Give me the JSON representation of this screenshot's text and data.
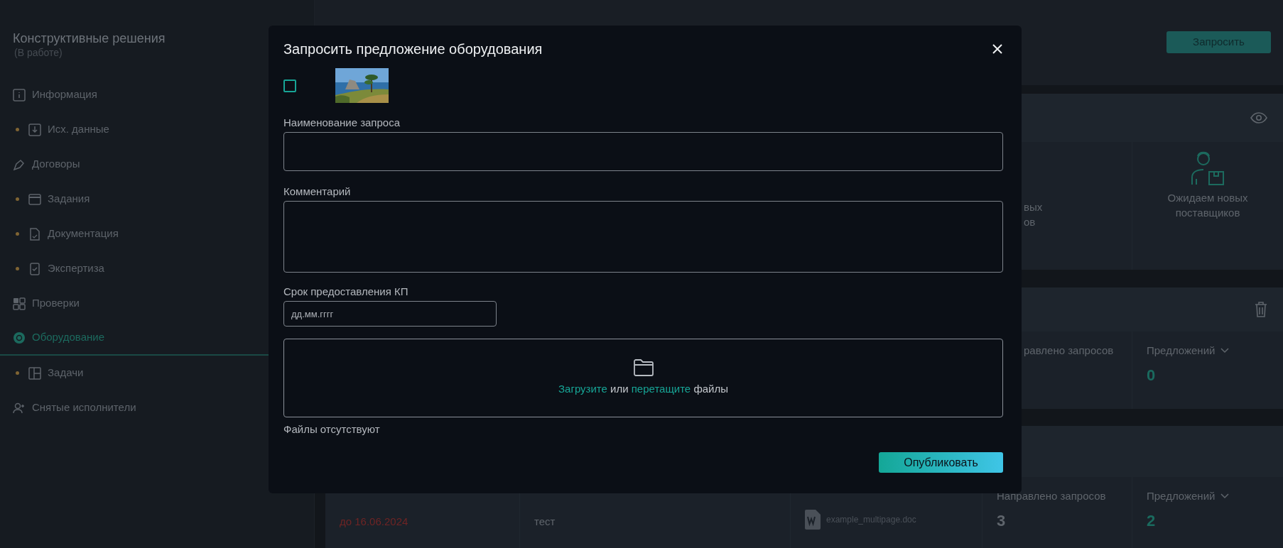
{
  "sidebar": {
    "title": "Конструктивные решения",
    "status": "(В работе)",
    "items": [
      {
        "label": "Информация",
        "flagged": false,
        "selected": false
      },
      {
        "label": "Исх. данные",
        "flagged": true,
        "selected": false
      },
      {
        "label": "Договоры",
        "flagged": false,
        "selected": false
      },
      {
        "label": "Задания",
        "flagged": true,
        "selected": false
      },
      {
        "label": "Документация",
        "flagged": true,
        "selected": false
      },
      {
        "label": "Экспертиза",
        "flagged": true,
        "selected": false
      },
      {
        "label": "Проверки",
        "flagged": false,
        "selected": false
      },
      {
        "label": "Оборудование",
        "flagged": false,
        "selected": true
      },
      {
        "label": "Задачи",
        "flagged": true,
        "selected": false
      },
      {
        "label": "Снятые исполнители",
        "flagged": false,
        "selected": false
      }
    ]
  },
  "header": {
    "request_button": "Запросить"
  },
  "summary_card": {
    "partial_lines": [
      "вых",
      "ов"
    ],
    "waiting_text": "Ожидаем новых поставщиков"
  },
  "requests_card": {
    "sent_label": "равлено запросов",
    "offers_label": "Предложений",
    "offers_value": "0"
  },
  "offers_card": {
    "columns": [
      {
        "kind": "date",
        "value": "до 16.06.2024",
        "overdue": true
      },
      {
        "kind": "text",
        "value": "тест"
      },
      {
        "kind": "file",
        "value": "example_multipage.doc"
      },
      {
        "kind": "count",
        "label": "Направлено запросов",
        "value": "3",
        "dropdown": false
      },
      {
        "kind": "count",
        "label": "Предложений",
        "value": "2",
        "dropdown": true
      }
    ]
  },
  "modal": {
    "title": "Запросить предложение оборудования",
    "checkbox": {
      "checked": false
    },
    "fields": [
      {
        "kind": "input",
        "label": "Наименование запроса"
      },
      {
        "kind": "textarea",
        "label": "Комментарий"
      },
      {
        "kind": "date",
        "label": "Срок предоставления КП",
        "placeholder": "дд.мм.гггг"
      }
    ],
    "dropzone": {
      "parts": [
        {
          "text": "Загрузите",
          "link": true
        },
        {
          "text": "или",
          "link": false
        },
        {
          "text": "перетащите",
          "link": true
        },
        {
          "text": "файлы",
          "link": false
        }
      ]
    },
    "files_note": "Файлы отсутствуют",
    "submit": "Опубликовать"
  }
}
